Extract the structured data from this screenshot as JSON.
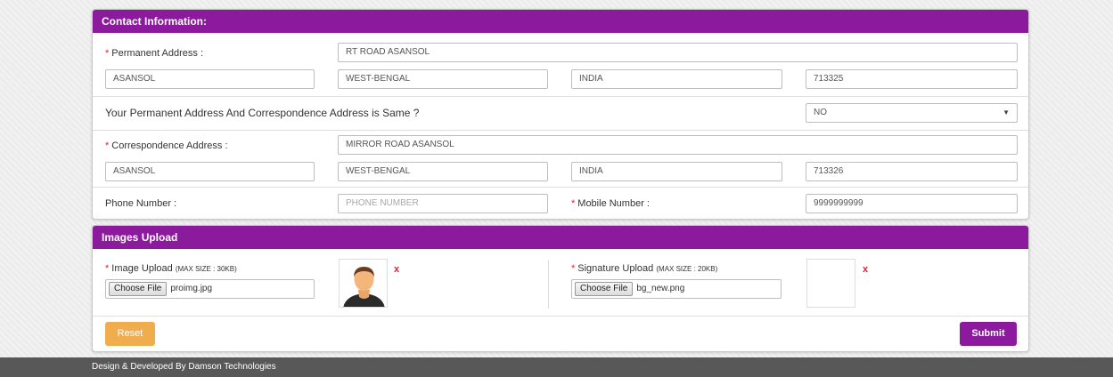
{
  "contact": {
    "header": "Contact Information:",
    "permanent": {
      "label": "Permanent Address :",
      "address": "RT ROAD ASANSOL",
      "city": "ASANSOL",
      "state": "WEST-BENGAL",
      "country": "INDIA",
      "pincode": "713325"
    },
    "same_question": "Your Permanent Address And Correspondence Address is Same ?",
    "same_value": "NO",
    "correspondence": {
      "label": "Correspondence Address :",
      "address": "MIRROR ROAD ASANSOL",
      "city": "ASANSOL",
      "state": "WEST-BENGAL",
      "country": "INDIA",
      "pincode": "713326"
    },
    "phone_label": "Phone Number :",
    "phone_placeholder": "PHONE NUMBER",
    "mobile_label": "Mobile Number :",
    "mobile_value": "9999999999"
  },
  "images": {
    "header": "Images Upload",
    "image_label": "Image Upload",
    "image_size": "(MAX SIZE : 30KB)",
    "image_button": "Choose File",
    "image_file": "proimg.jpg",
    "signature_label": "Signature Upload",
    "signature_size": "(MAX SIZE : 20KB)",
    "signature_button": "Choose File",
    "signature_file": "bg_new.png",
    "remove_symbol": "x",
    "required_mark": "*"
  },
  "actions": {
    "reset": "Reset",
    "submit": "Submit",
    "reset_color": "#f0ad4e",
    "submit_color": "#8b1a9c"
  },
  "footer": {
    "text": "Design & Developed By Damson Technologies"
  },
  "icons": {
    "select_arrow": "triangle-down-icon",
    "avatar": "user-avatar-icon"
  }
}
